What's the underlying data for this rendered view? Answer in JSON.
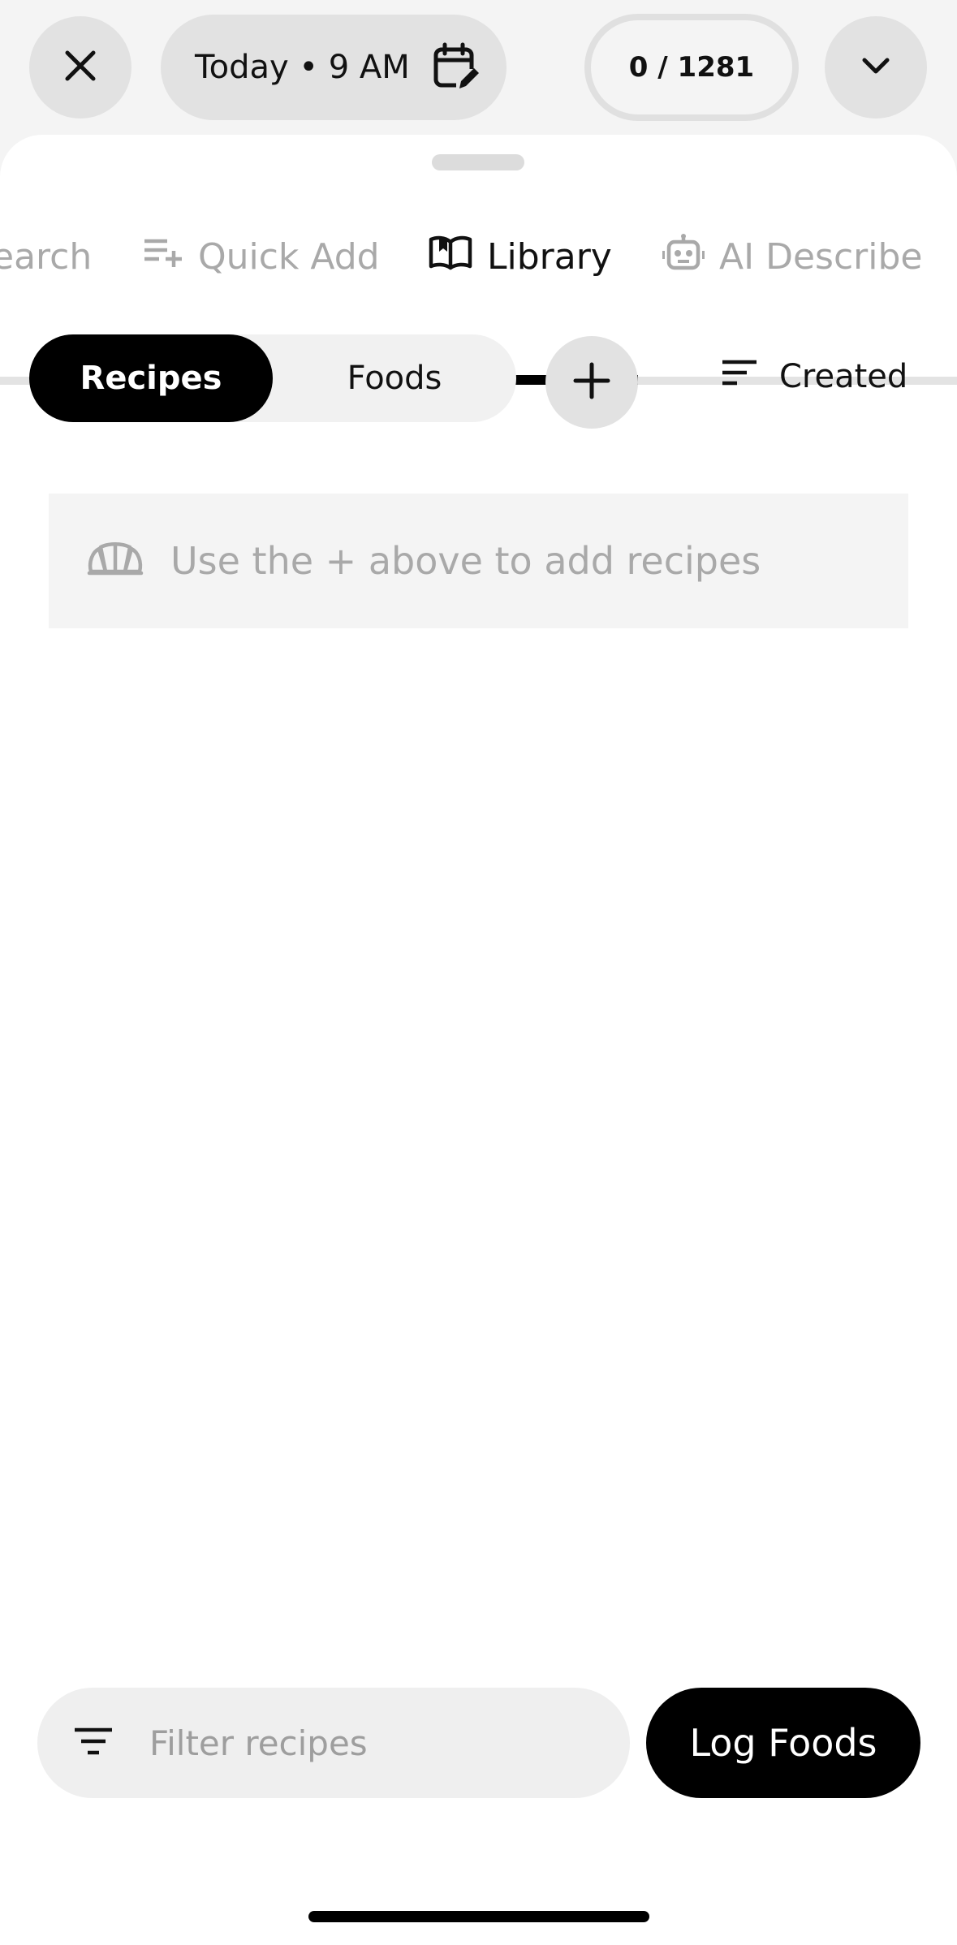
{
  "header": {
    "date_label": "Today • 9 AM",
    "count_label": "0 / 1281"
  },
  "tabs": [
    {
      "label": "earch",
      "icon": "search-tab",
      "active": false
    },
    {
      "label": "Quick Add",
      "icon": "playlist-add-icon",
      "active": false
    },
    {
      "label": "Library",
      "icon": "book-open-icon",
      "active": true
    },
    {
      "label": "AI Describe",
      "icon": "robot-icon",
      "active": false
    }
  ],
  "segment": {
    "recipes_label": "Recipes",
    "foods_label": "Foods",
    "selected": "Recipes"
  },
  "sort": {
    "label": "Created"
  },
  "empty_state": {
    "message": "Use the + above to add recipes"
  },
  "filter": {
    "placeholder": "Filter recipes",
    "value": ""
  },
  "log_button": {
    "label": "Log Foods"
  },
  "colors": {
    "accent": "#000000",
    "muted_text": "#a9a9a9",
    "pill_bg": "#e2e2e2",
    "sheet_bg": "#ffffff",
    "page_bg": "#f4f4f4"
  }
}
